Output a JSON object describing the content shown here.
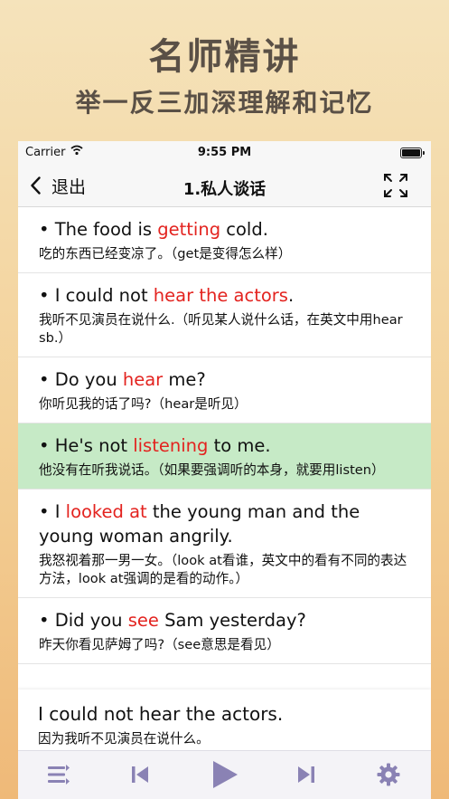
{
  "promo": {
    "title": "名师精讲",
    "subtitle": "举一反三加深理解和记忆"
  },
  "status_bar": {
    "carrier": "Carrier",
    "time": "9:55 PM"
  },
  "nav": {
    "back_label": "退出",
    "title": "1.私人谈话",
    "expand_icon": "expand-icon"
  },
  "rows": [
    {
      "segments": [
        "• The food is ",
        "getting",
        " cold."
      ],
      "zh": "吃的东西已经变凉了。（get是变得怎么样）"
    },
    {
      "segments": [
        "• I could not ",
        "hear the actors",
        "."
      ],
      "zh": "我听不见演员在说什么.（听见某人说什么话，在英文中用hear sb.）"
    },
    {
      "segments": [
        "• Do you ",
        "hear",
        " me?"
      ],
      "zh": "你听见我的话了吗?（hear是听见）"
    },
    {
      "segments": [
        "• He's not ",
        "listening",
        " to me."
      ],
      "zh": "他没有在听我说话。（如果要强调听的本身，就要用listen）"
    },
    {
      "segments": [
        "• I ",
        "looked at",
        " the young man and the young woman angrily."
      ],
      "zh": "我怒视着那一男一女。（look at看谁，英文中的看有不同的表达方法，look at强调的是看的动作。）"
    },
    {
      "segments": [
        "• Did you ",
        "see",
        " Sam yesterday?"
      ],
      "zh": "昨天你看见萨姆了吗?（see意思是看见）"
    }
  ],
  "active_row_index": 3,
  "now_playing": {
    "en": "I could not hear the actors.",
    "zh": "因为我听不见演员在说什么。"
  },
  "toolbar": {
    "icons": [
      "list-icon",
      "previous-icon",
      "play-icon",
      "next-icon",
      "settings-icon"
    ]
  },
  "colors": {
    "highlight": "#e3231f",
    "active_row": "#c6eac6",
    "toolbar_icon": "#8a82b4",
    "promo_text": "#5a5046"
  }
}
